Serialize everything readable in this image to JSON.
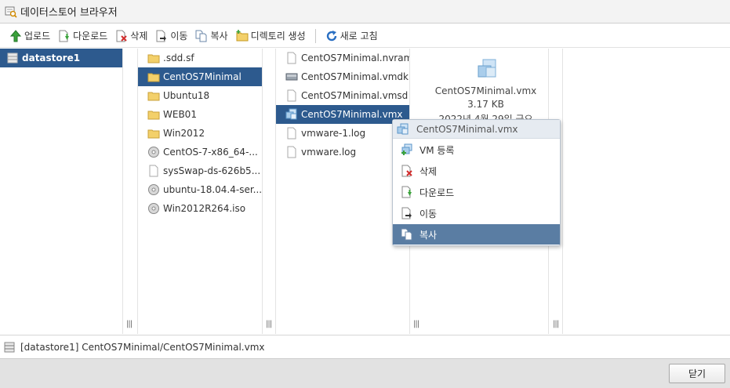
{
  "window": {
    "title": "데이터스토어 브라우저"
  },
  "toolbar": {
    "upload": "업로드",
    "download": "다운로드",
    "delete": "삭제",
    "move": "이동",
    "copy": "복사",
    "mkdir": "디렉토리 생성",
    "refresh": "새로 고침"
  },
  "datastores": [
    {
      "name": "datastore1",
      "selected": true
    }
  ],
  "folders": [
    {
      "name": ".sdd.sf",
      "icon": "folder-icon"
    },
    {
      "name": "CentOS7Minimal",
      "icon": "folder-icon",
      "selected": true
    },
    {
      "name": "Ubuntu18",
      "icon": "folder-icon"
    },
    {
      "name": "WEB01",
      "icon": "folder-icon"
    },
    {
      "name": "Win2012",
      "icon": "folder-icon"
    },
    {
      "name": "CentOS-7-x86_64-...",
      "icon": "disc-icon"
    },
    {
      "name": "sysSwap-ds-626b5...",
      "icon": "file-icon"
    },
    {
      "name": "ubuntu-18.04.4-ser...",
      "icon": "disc-icon"
    },
    {
      "name": "Win2012R264.iso",
      "icon": "disc-icon"
    }
  ],
  "files": [
    {
      "name": "CentOS7Minimal.nvram",
      "icon": "file-icon"
    },
    {
      "name": "CentOS7Minimal.vmdk",
      "icon": "disk-icon"
    },
    {
      "name": "CentOS7Minimal.vmsd",
      "icon": "file-icon"
    },
    {
      "name": "CentOS7Minimal.vmx",
      "icon": "vm-icon",
      "selected": true
    },
    {
      "name": "vmware-1.log",
      "icon": "file-icon"
    },
    {
      "name": "vmware.log",
      "icon": "file-icon"
    }
  ],
  "detail": {
    "name": "CentOS7Minimal.vmx",
    "size": "3.17 KB",
    "date": "2022년 4월 29일 금요"
  },
  "context_menu": {
    "header": "CentOS7Minimal.vmx",
    "items": [
      {
        "label": "VM 등록",
        "icon": "register-vm-icon"
      },
      {
        "label": "삭제",
        "icon": "delete-icon"
      },
      {
        "label": "다운로드",
        "icon": "download-icon"
      },
      {
        "label": "이동",
        "icon": "move-icon"
      },
      {
        "label": "복사",
        "icon": "copy-icon",
        "highlighted": true
      }
    ]
  },
  "status": {
    "path": "[datastore1] CentOS7Minimal/CentOS7Minimal.vmx"
  },
  "footer": {
    "close": "닫기"
  },
  "colors": {
    "selection": "#2d5a8e",
    "menu_highlight": "#5a7da3",
    "footer": "#e2e2e2"
  }
}
